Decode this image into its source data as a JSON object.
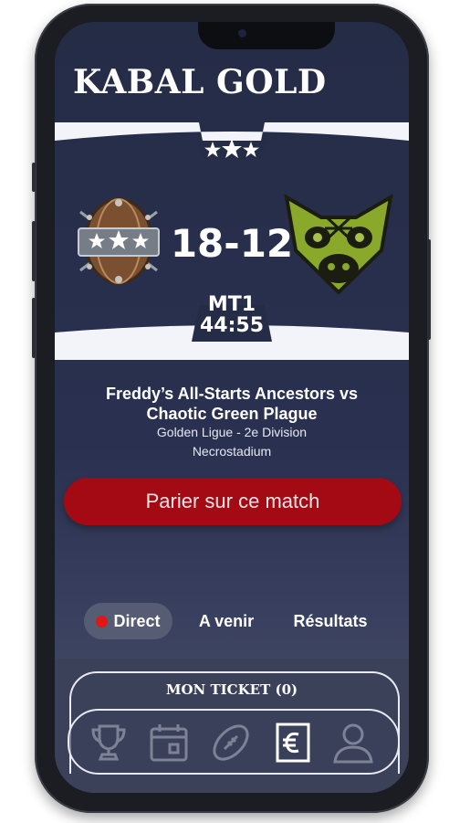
{
  "app": {
    "title": "KABAL GOLD"
  },
  "match": {
    "score": "18-12",
    "period": "MT1",
    "clock": "44:55",
    "teams": "Freddy’s All-Starts Ancestors vs Chaotic Green Plague",
    "league": "Golden Ligue - 2e Division",
    "stadium": "Necrostadium"
  },
  "actions": {
    "bet_label": "Parier sur ce match"
  },
  "tabs": [
    {
      "label": "Direct",
      "active": true
    },
    {
      "label": "A venir",
      "active": false
    },
    {
      "label": "Résultats",
      "active": false
    }
  ],
  "ticket": {
    "label": "MON TICKET (0)"
  },
  "nav": [
    {
      "icon": "trophy-icon",
      "active": false
    },
    {
      "icon": "calendar-icon",
      "active": false
    },
    {
      "icon": "football-icon",
      "active": false
    },
    {
      "icon": "euro-ticket-icon",
      "active": true
    },
    {
      "icon": "user-icon",
      "active": false
    }
  ],
  "colors": {
    "accent": "#a30a13",
    "live_dot": "#e11616",
    "background": "#252c46",
    "band": "#f2f4fa"
  }
}
